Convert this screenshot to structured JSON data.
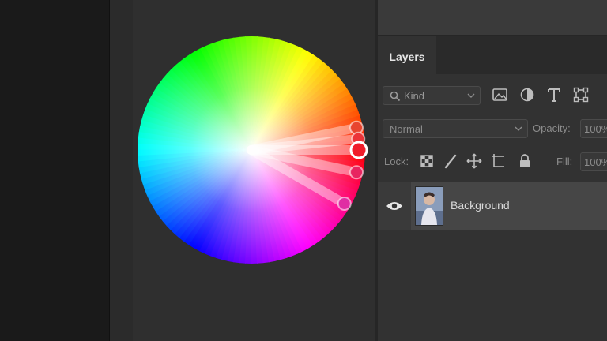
{
  "panel": {
    "tabs": [
      {
        "label": "Layers"
      }
    ],
    "filter": {
      "label": "Kind",
      "icon": "search-icon"
    },
    "filter_tools": [
      "image-filter-icon",
      "adjustment-filter-icon",
      "type-filter-icon",
      "shape-filter-icon"
    ],
    "blend_mode": "Normal",
    "opacity_label": "Opacity:",
    "opacity_value": "100%",
    "lock_label": "Lock:",
    "lock_icons": [
      "lock-transparent-pixels-icon",
      "lock-image-pixels-icon",
      "lock-position-icon",
      "lock-artboard-icon",
      "lock-all-icon"
    ],
    "fill_label": "Fill:",
    "fill_value": "100%"
  },
  "layers": [
    {
      "name": "Background",
      "visible": true
    }
  ],
  "color_wheel": {
    "handles": [
      {
        "hue": 12,
        "color": "#e8452f"
      },
      {
        "hue": 6,
        "color": "#ec3438"
      },
      {
        "hue": 0,
        "color": "#f01c2a",
        "selected": true
      },
      {
        "hue": 348,
        "color": "#e82460"
      },
      {
        "hue": 330,
        "color": "#e02da3"
      }
    ]
  },
  "colors": {
    "canvas_bg": "#2f2f2f",
    "panel_bg": "#323232",
    "text": "#e6e6e6",
    "muted_text": "#8c8c8c"
  }
}
